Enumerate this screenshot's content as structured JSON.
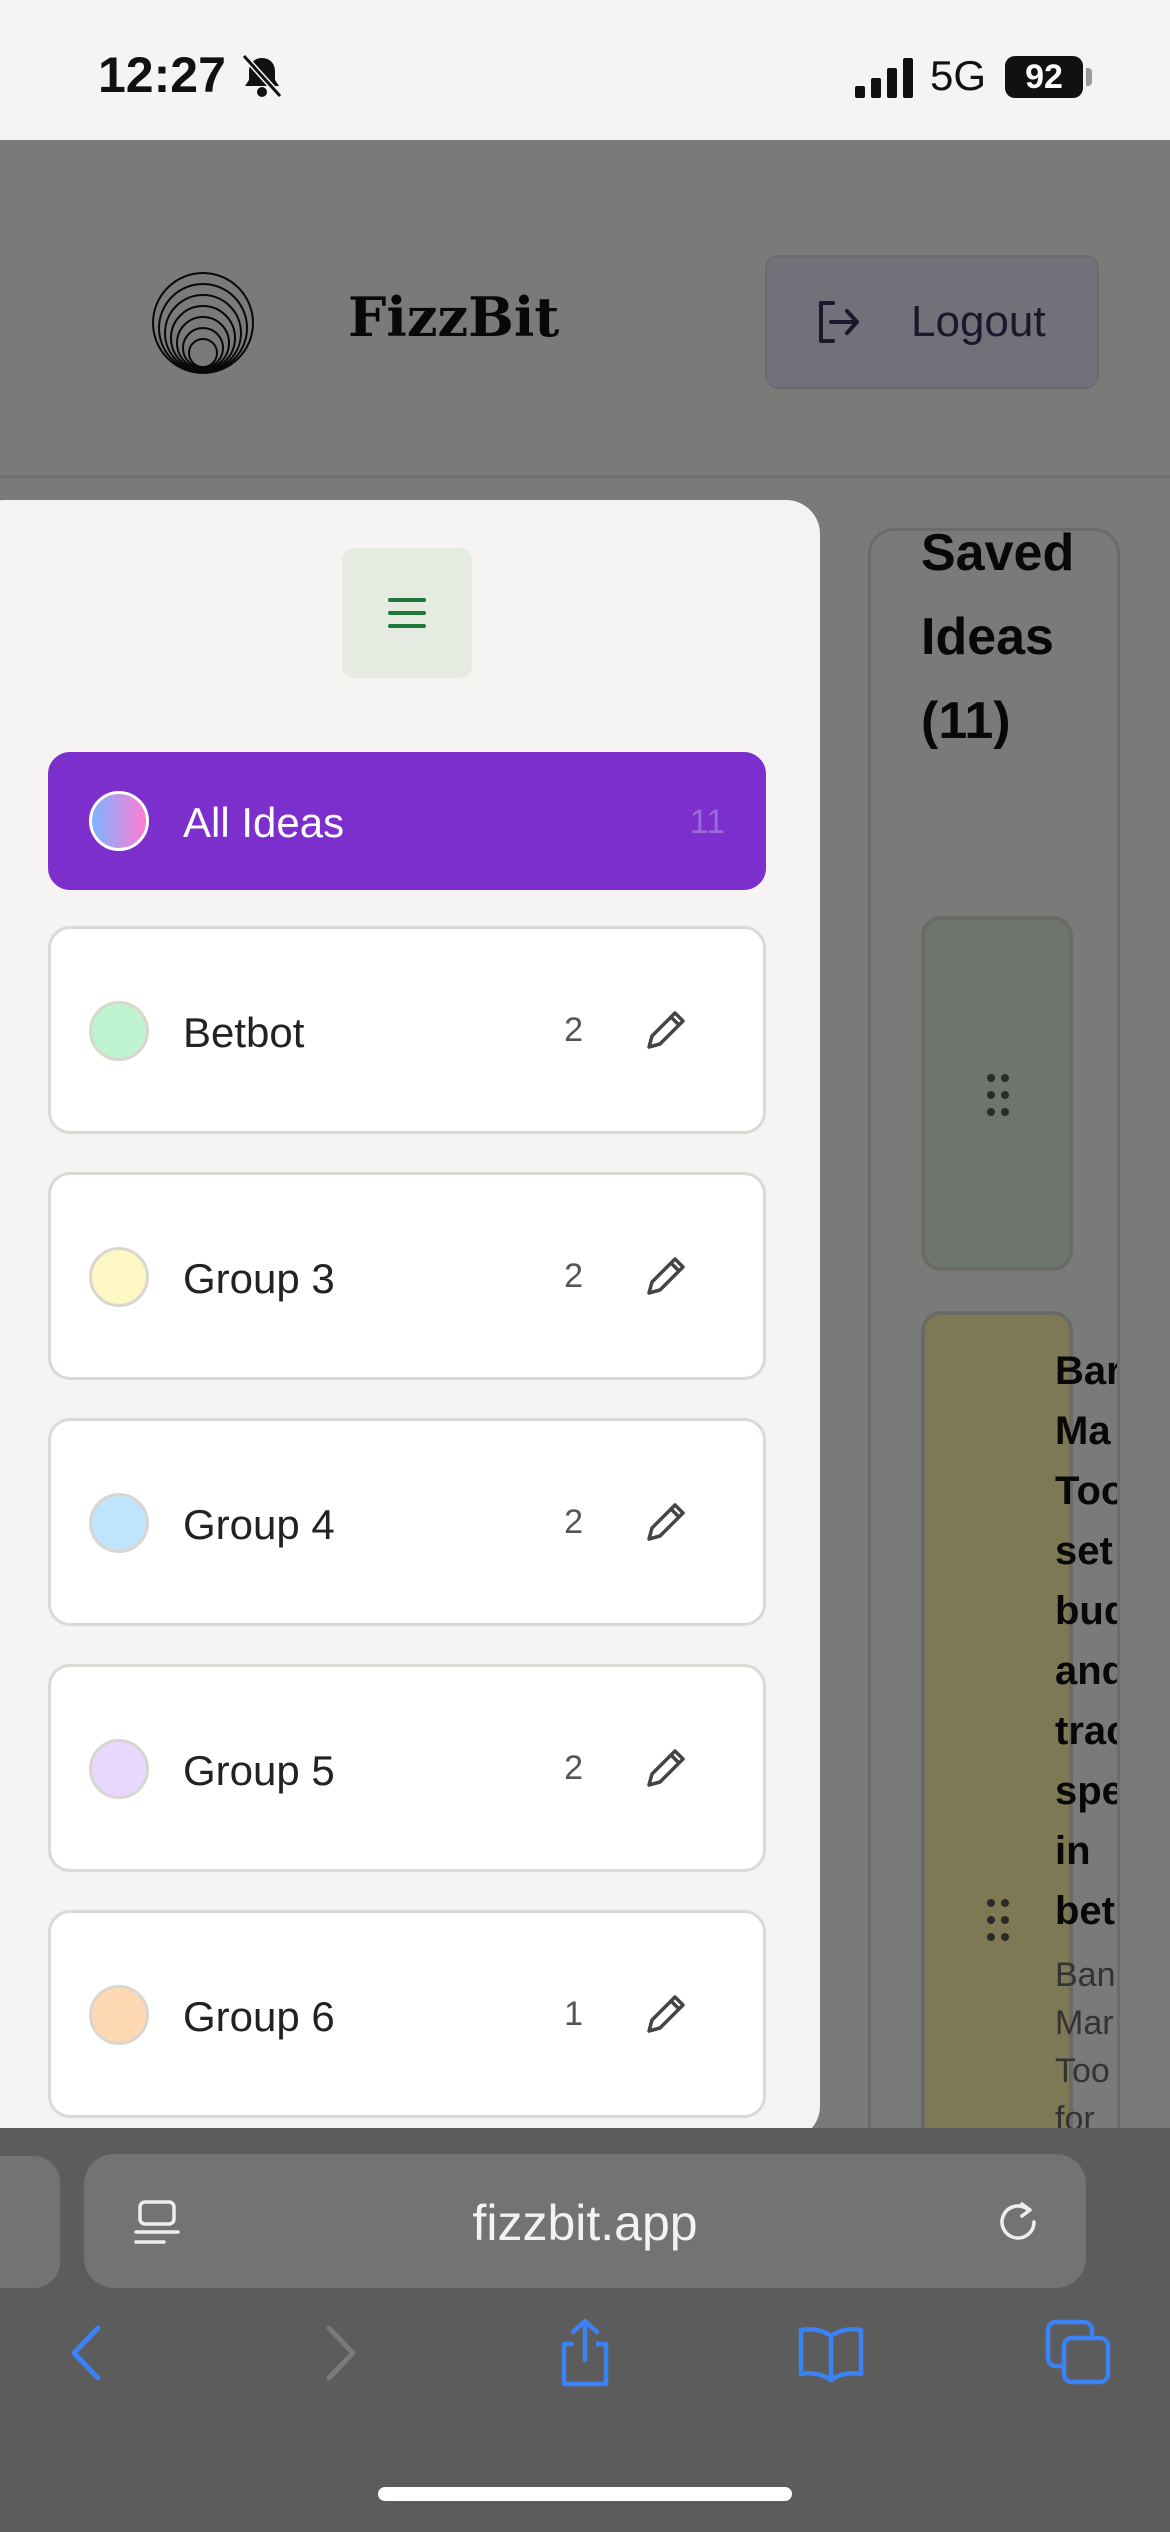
{
  "status_bar": {
    "time": "12:27",
    "network": "5G",
    "battery": "92"
  },
  "header": {
    "brand": "FizzBit",
    "logout_label": "Logout"
  },
  "saved": {
    "title": "Saved\nIdeas\n(11)",
    "card_title": "Bar\nMa\nToo\nset\nbud\nand\ntrac\nspe\nin\nbet",
    "card_desc": "Ban\nMar\nToo\nfor\nsett\nbud\nand"
  },
  "drawer": {
    "groups": [
      {
        "name": "All Ideas",
        "count": "11",
        "color": "linear-gradient(90deg,#7db4ff,#ff7ad2)",
        "active": true
      },
      {
        "name": "Betbot",
        "count": "2",
        "color": "#bff2cf"
      },
      {
        "name": "Group 3",
        "count": "2",
        "color": "#fdf7c3"
      },
      {
        "name": "Group 4",
        "count": "2",
        "color": "#bfe4fb"
      },
      {
        "name": "Group 5",
        "count": "2",
        "color": "#e8d8fd"
      },
      {
        "name": "Group 6",
        "count": "1",
        "color": "#fed8b2"
      }
    ]
  },
  "browser": {
    "url": "fizzbit.app"
  },
  "colors": {
    "accent": "#7c2fcc",
    "browser_icons": "#3b82f6"
  },
  "icons": [
    "bell-slash-icon",
    "signal-icon",
    "logout-icon",
    "hamburger-icon",
    "pencil-icon",
    "grip-icon",
    "reader-icon",
    "reload-icon",
    "back-icon",
    "forward-icon",
    "share-icon",
    "bookmarks-icon",
    "tabs-icon"
  ]
}
